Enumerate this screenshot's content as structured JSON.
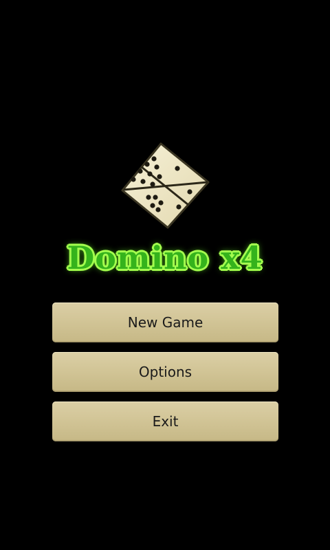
{
  "app": {
    "title": "Domino x4",
    "logo_icon": "domino-diamond-icon"
  },
  "menu": {
    "new_game_label": "New Game",
    "options_label": "Options",
    "exit_label": "Exit"
  },
  "colors": {
    "background": "#000000",
    "title_green": "#35b31c",
    "title_glow": "#a4ff4e",
    "button_face": "#d2c597",
    "button_text": "#1a1a1a"
  }
}
